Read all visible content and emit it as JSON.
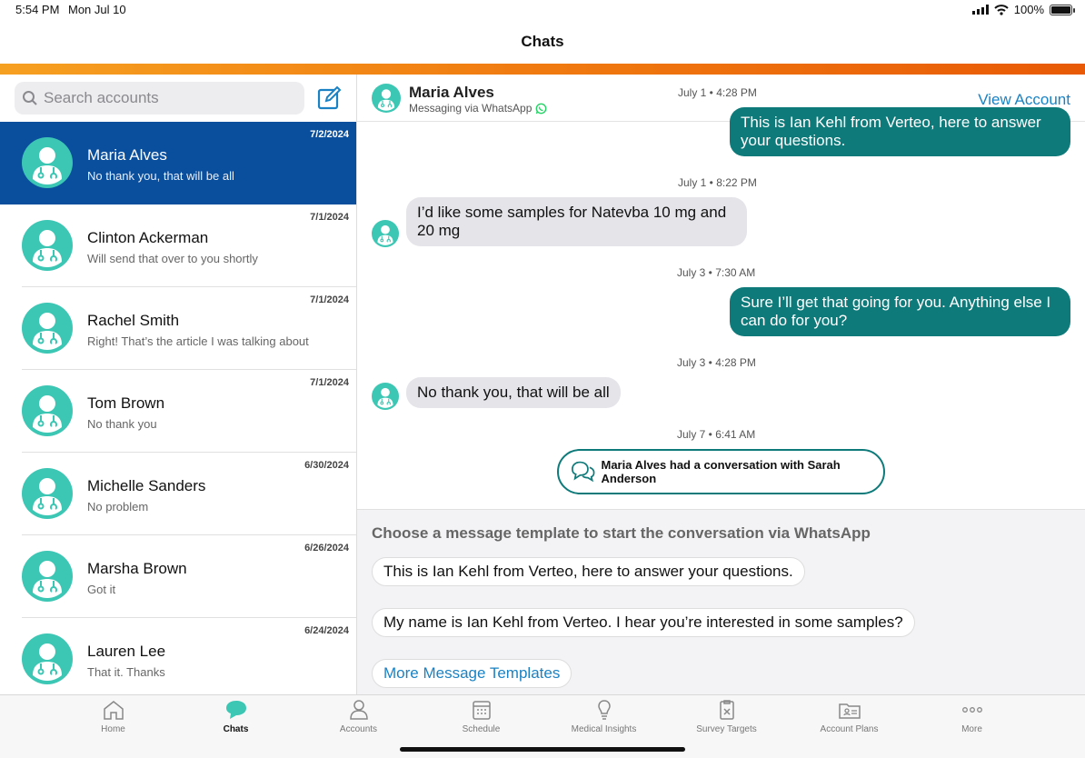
{
  "status": {
    "time": "5:54 PM",
    "date": "Mon Jul 10",
    "battery": "100%"
  },
  "nav": {
    "title": "Chats"
  },
  "search": {
    "placeholder": "Search accounts"
  },
  "conversations": [
    {
      "name": "Maria Alves",
      "preview": "No thank you, that will be all",
      "date": "7/2/2024",
      "active": true
    },
    {
      "name": "Clinton Ackerman",
      "preview": "Will send that over to you shortly",
      "date": "7/1/2024"
    },
    {
      "name": "Rachel Smith",
      "preview": "Right! That’s the article I was talking about",
      "date": "7/1/2024"
    },
    {
      "name": "Tom Brown",
      "preview": "No thank you",
      "date": "7/1/2024"
    },
    {
      "name": "Michelle Sanders",
      "preview": "No problem",
      "date": "6/30/2024"
    },
    {
      "name": "Marsha Brown",
      "preview": "Got it",
      "date": "6/26/2024"
    },
    {
      "name": "Lauren Lee",
      "preview": "That it. Thanks",
      "date": "6/24/2024"
    }
  ],
  "chat": {
    "contact_name": "Maria Alves",
    "channel": "Messaging via WhatsApp",
    "view_account": "View Account",
    "messages": [
      {
        "stamp": "July 1 • 4:28 PM",
        "direction": "out",
        "text": "This is Ian Kehl from Verteo, here to answer your questions."
      },
      {
        "stamp": "July 1 • 8:22 PM",
        "direction": "in",
        "text": "I’d like some samples for Natevba 10 mg and 20 mg"
      },
      {
        "stamp": "July 3 • 7:30 AM",
        "direction": "out",
        "text": "Sure I’ll get that going for you. Anything else I can do for you?"
      },
      {
        "stamp": "July 3 • 4:28 PM",
        "direction": "in",
        "text": "No thank you, that will be all"
      }
    ],
    "system_stamp": "July 7 • 6:41 AM",
    "system_note": "Maria Alves had a conversation with Sarah Anderson"
  },
  "templates": {
    "heading": "Choose a message template to start the conversation via WhatsApp",
    "items": [
      "This is Ian Kehl from Verteo, here to answer your questions.",
      "My name is Ian Kehl from Verteo. I hear you’re interested in some samples?"
    ],
    "more": "More Message Templates"
  },
  "tabs": [
    {
      "label": "Home",
      "icon": "home-icon"
    },
    {
      "label": "Chats",
      "icon": "chat-bubble-icon",
      "active": true
    },
    {
      "label": "Accounts",
      "icon": "accounts-icon"
    },
    {
      "label": "Schedule",
      "icon": "calendar-icon"
    },
    {
      "label": "Medical Insights",
      "icon": "lightbulb-icon"
    },
    {
      "label": "Survey Targets",
      "icon": "clipboard-icon"
    },
    {
      "label": "Account Plans",
      "icon": "folder-plans-icon"
    },
    {
      "label": "More",
      "icon": "more-dots-icon"
    }
  ],
  "colors": {
    "accent_blue": "#0a4f9e",
    "teal": "#0f7a7a",
    "avatar": "#3cc6b4",
    "link": "#1a82c4"
  }
}
